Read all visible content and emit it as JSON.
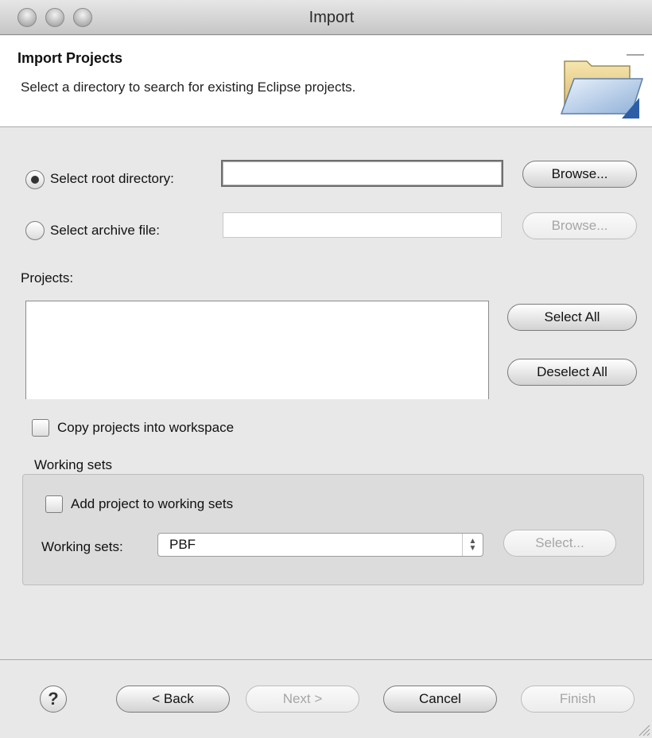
{
  "window": {
    "title": "Import"
  },
  "header": {
    "title": "Import Projects",
    "description": "Select a directory to search for existing Eclipse projects."
  },
  "source": {
    "root_directory": {
      "label": "Select root directory:",
      "value": "",
      "selected": true,
      "browse_label": "Browse..."
    },
    "archive_file": {
      "label": "Select archive file:",
      "value": "",
      "selected": false,
      "browse_label": "Browse..."
    }
  },
  "projects": {
    "label": "Projects:",
    "items": [],
    "select_all_label": "Select All",
    "deselect_all_label": "Deselect All"
  },
  "options": {
    "copy_into_workspace_label": "Copy projects into workspace",
    "copy_into_workspace_checked": false
  },
  "working_sets": {
    "group_label": "Working sets",
    "add_label": "Add project to working sets",
    "add_checked": false,
    "select_label": "Working sets:",
    "selected_value": "PBF",
    "select_button_label": "Select..."
  },
  "footer": {
    "help_glyph": "?",
    "back_label": "< Back",
    "next_label": "Next >",
    "cancel_label": "Cancel",
    "finish_label": "Finish"
  },
  "icons": {
    "header": "folder-open-icon",
    "help": "help-icon",
    "resize": "resize-grip-icon"
  }
}
